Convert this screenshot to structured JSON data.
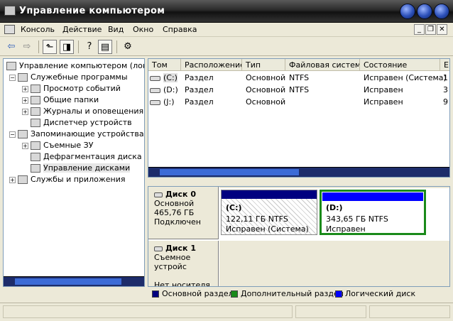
{
  "window": {
    "title": "Управление компьютером"
  },
  "menubar": {
    "items": [
      "Консоль",
      "Действие",
      "Вид",
      "Окно",
      "Справка"
    ]
  },
  "tree": {
    "items": [
      {
        "label": "Управление компьютером (локаль",
        "level": 0,
        "expander": "",
        "icon": "computer-icon"
      },
      {
        "label": "Служебные программы",
        "level": 1,
        "expander": "-",
        "icon": "tools-icon"
      },
      {
        "label": "Просмотр событий",
        "level": 2,
        "expander": "+",
        "icon": "event-viewer-icon"
      },
      {
        "label": "Общие папки",
        "level": 2,
        "expander": "+",
        "icon": "shared-folder-icon"
      },
      {
        "label": "Журналы и оповещения пр",
        "level": 2,
        "expander": "+",
        "icon": "logs-icon"
      },
      {
        "label": "Диспетчер устройств",
        "level": 2,
        "expander": "",
        "icon": "device-manager-icon"
      },
      {
        "label": "Запоминающие устройства",
        "level": 1,
        "expander": "-",
        "icon": "storage-icon"
      },
      {
        "label": "Съемные ЗУ",
        "level": 2,
        "expander": "+",
        "icon": "removable-storage-icon"
      },
      {
        "label": "Дефрагментация диска",
        "level": 2,
        "expander": "",
        "icon": "defrag-icon"
      },
      {
        "label": "Управление дисками",
        "level": 2,
        "expander": "",
        "icon": "disk-management-icon",
        "selected": true
      },
      {
        "label": "Службы и приложения",
        "level": 1,
        "expander": "+",
        "icon": "services-icon"
      }
    ]
  },
  "volumes": {
    "headers": [
      "Том",
      "Расположение",
      "Тип",
      "Файловая система",
      "Состояние",
      "Е"
    ],
    "rows": [
      {
        "vol": "(C:)",
        "layout": "Раздел",
        "type": "Основной",
        "fs": "NTFS",
        "status": "Исправен (Система)",
        "cap": "1"
      },
      {
        "vol": "(D:)",
        "layout": "Раздел",
        "type": "Основной",
        "fs": "NTFS",
        "status": "Исправен",
        "cap": "3"
      },
      {
        "vol": "(J:)",
        "layout": "Раздел",
        "type": "Основной",
        "fs": "",
        "status": "Исправен",
        "cap": "9"
      }
    ]
  },
  "disks": {
    "disk0": {
      "name": "Диск 0",
      "type": "Основной",
      "size": "465,76 ГБ",
      "state": "Подключен",
      "parts": [
        {
          "label": "(C:)",
          "size": "122,11 ГБ NTFS",
          "status": "Исправен (Система)"
        },
        {
          "label": "(D:)",
          "size": "343,65 ГБ NTFS",
          "status": "Исправен"
        }
      ]
    },
    "disk1": {
      "name": "Диск 1",
      "type": "Съемное устройс",
      "state": "Нет носителя"
    }
  },
  "legend": {
    "primary": "Основной раздел",
    "extended": "Дополнительный раздел",
    "logical": "Логический диск"
  },
  "colors": {
    "primary": "#000080",
    "extended": "#1a8a1a",
    "logical": "#0000ff"
  }
}
